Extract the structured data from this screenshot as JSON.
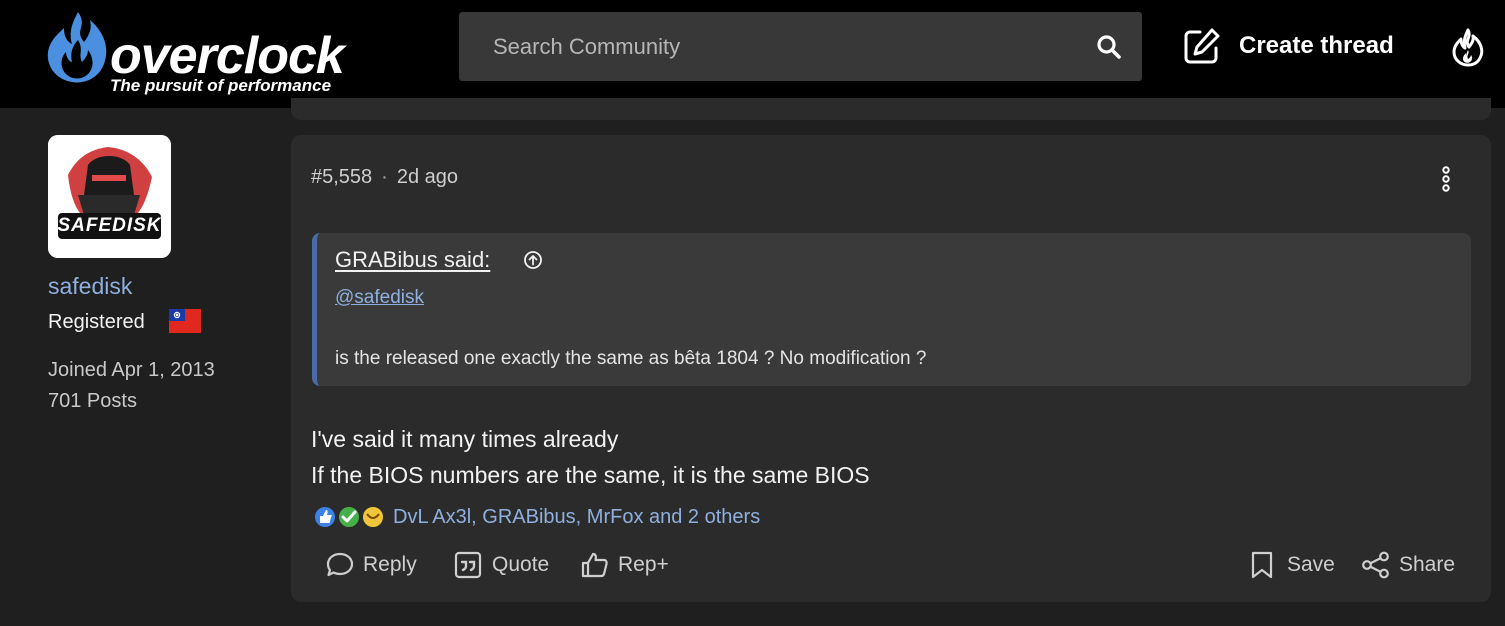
{
  "header": {
    "logo_text": "overclock",
    "logo_tagline": "The pursuit of performance",
    "search_placeholder": "Search Community",
    "create_thread_label": "Create thread"
  },
  "user": {
    "name": "safedisk",
    "role": "Registered",
    "joined": "Joined Apr 1, 2013",
    "posts": "701 Posts",
    "avatar_text": "SAFEDISK"
  },
  "post": {
    "number": "#5,558",
    "separator": "·",
    "time": "2d ago",
    "quote": {
      "author": "GRABibus said:",
      "mention": "@safedisk",
      "text": "is the released one exactly the same as bêta 1804 ? No modification ?"
    },
    "body_line1": "I've said it many times already",
    "body_line2": "If the BIOS numbers are the same, it is the same BIOS",
    "reactions_text": "DvL Ax3l, GRABibus, MrFox and 2 others",
    "actions": {
      "reply": "Reply",
      "quote": "Quote",
      "rep": "Rep+",
      "save": "Save",
      "share": "Share"
    }
  },
  "colors": {
    "accent_link": "#8fb0df",
    "quote_border": "#4b6aa6",
    "card_bg": "#2b2b2b",
    "page_bg": "#1f1f1f",
    "header_bg": "#000000"
  }
}
